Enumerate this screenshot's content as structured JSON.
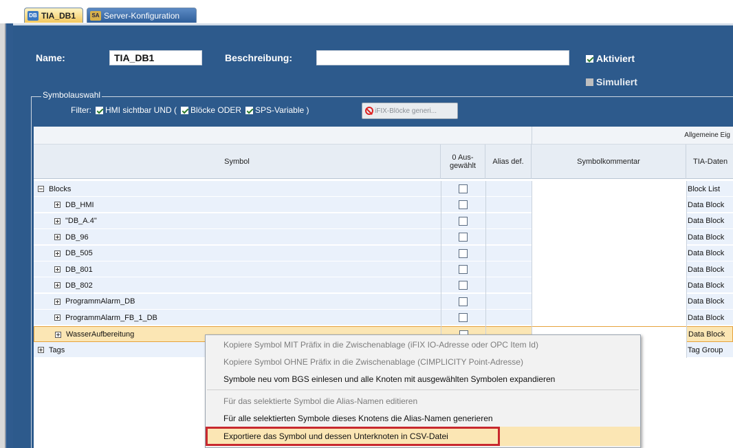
{
  "tabs": [
    {
      "label": "TIA_DB1",
      "icon": "db-icon"
    },
    {
      "label": "Server-Konfiguration",
      "icon": "server-config-icon"
    }
  ],
  "form": {
    "name_label": "Name:",
    "name_value": "TIA_DB1",
    "description_label": "Beschreibung:",
    "description_value": "",
    "activated_label": "Aktiviert",
    "activated_checked": true,
    "simulated_label": "Simuliert",
    "simulated_checked": false
  },
  "symbol_selection": {
    "legend": "Symbolauswahl",
    "filter_label": "Filter:",
    "filter_part1": "HMI sichtbar UND (",
    "filter_part2": "Blöcke ODER",
    "filter_part3": "SPS-Variable )",
    "generate_button": "iFIX-Blöcke generi..."
  },
  "grid": {
    "group_header": "Allgemeine Eig",
    "columns": {
      "symbol": "Symbol",
      "selected_line1": "0 Aus-",
      "selected_line2": "gewählt",
      "alias": "Alias def.",
      "comment": "Symbolkommentar",
      "tia_type": "TIA-Daten"
    },
    "rows": [
      {
        "label": "Blocks",
        "type": "Block List",
        "expand": "minus",
        "indent": 0,
        "selected": false
      },
      {
        "label": "DB_HMI",
        "type": "Data Block",
        "expand": "plus",
        "indent": 1,
        "selected": false
      },
      {
        "label": "\"DB_A.4\"",
        "type": "Data Block",
        "expand": "plus",
        "indent": 1,
        "selected": false
      },
      {
        "label": "DB_96",
        "type": "Data Block",
        "expand": "plus",
        "indent": 1,
        "selected": false
      },
      {
        "label": "DB_505",
        "type": "Data Block",
        "expand": "plus",
        "indent": 1,
        "selected": false
      },
      {
        "label": "DB_801",
        "type": "Data Block",
        "expand": "plus",
        "indent": 1,
        "selected": false
      },
      {
        "label": "DB_802",
        "type": "Data Block",
        "expand": "plus",
        "indent": 1,
        "selected": false
      },
      {
        "label": "ProgrammAlarm_DB",
        "type": "Data Block",
        "expand": "plus",
        "indent": 1,
        "selected": false
      },
      {
        "label": "ProgrammAlarm_FB_1_DB",
        "type": "Data Block",
        "expand": "plus",
        "indent": 1,
        "selected": false
      },
      {
        "label": "WasserAufbereitung",
        "type": "Data Block",
        "expand": "plus",
        "indent": 1,
        "selected": true
      },
      {
        "label": "Tags",
        "type": "Tag Group",
        "expand": "plus",
        "indent": 0,
        "selected": false
      }
    ]
  },
  "context_menu": {
    "items": [
      {
        "label": "Kopiere Symbol MIT Präfix in die Zwischenablage (iFIX IO-Adresse oder OPC Item Id)",
        "enabled": false
      },
      {
        "label": "Kopiere Symbol OHNE Präfix in die Zwischenablage (CIMPLICITY Point-Adresse)",
        "enabled": false
      },
      {
        "label": "Symbole neu vom BGS einlesen und alle Knoten mit ausgewählten Symbolen expandieren",
        "enabled": true
      },
      {
        "label": "Für das selektierte Symbol die Alias-Namen editieren",
        "enabled": false
      },
      {
        "label": "Für alle selektierten Symbole dieses Knotens die Alias-Namen generieren",
        "enabled": true
      },
      {
        "label": "Exportiere das Symbol und dessen Unterknoten in CSV-Datei",
        "enabled": true,
        "highlighted": true
      }
    ]
  },
  "colors": {
    "panel": "#2d5a8c",
    "row": "#eaf1fb",
    "selected_row": "#fbe6b4",
    "highlight_border": "#c8282e"
  }
}
